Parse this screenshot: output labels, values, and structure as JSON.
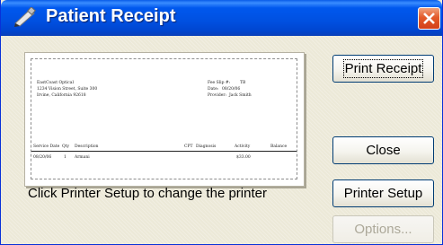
{
  "window": {
    "title": "Patient Receipt"
  },
  "receipt": {
    "practice_name": "EastCoast Optical",
    "address_line": "1234 Vision Street, Suite 300",
    "city_line": "Irvine, California 92618",
    "fee_slip_label": "Fee Slip #:",
    "fee_slip_value": "TB",
    "date_label": "Date:",
    "date_value": "08/20/06",
    "provider_label": "Provider:",
    "provider_value": "Jack Smith",
    "columns": [
      "Service Date",
      "Qty",
      "Description",
      "CPT",
      "Diagnosis",
      "Activity",
      "Balance"
    ],
    "rows": [
      {
        "service_date": "08/20/06",
        "qty": "1",
        "description": "Armani",
        "activity": "$33.00"
      }
    ]
  },
  "buttons": {
    "print_receipt": "Print Receipt",
    "close": "Close",
    "printer_setup": "Printer Setup",
    "options": "Options..."
  },
  "hint_text": "Click Printer Setup to change the printer",
  "colors": {
    "title_bar": "#0058ee",
    "dialog_bg": "#ece9d8",
    "close_button": "#e35a2a"
  }
}
